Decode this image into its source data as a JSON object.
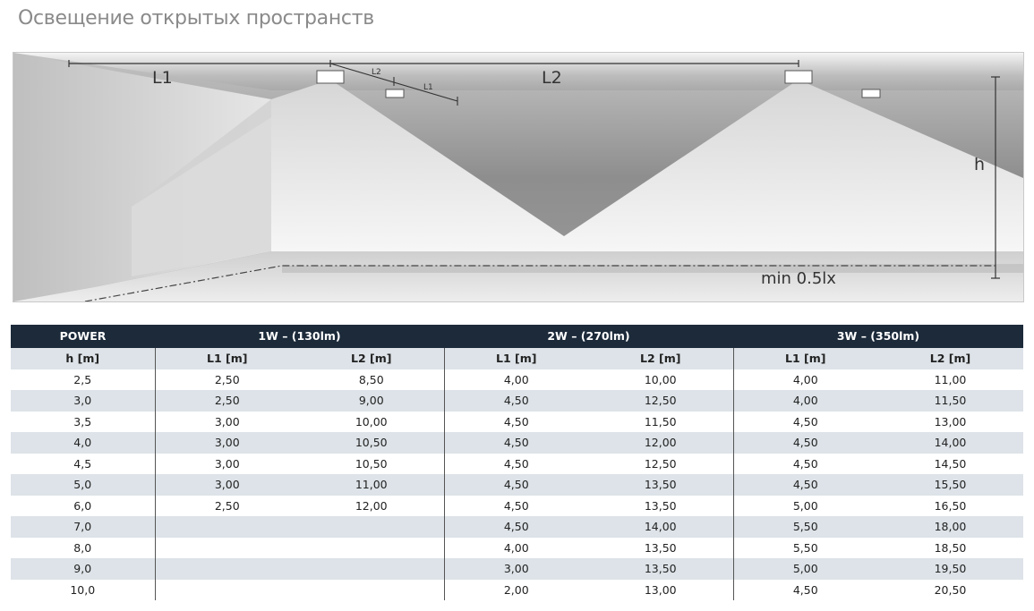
{
  "title": "Освещение открытых пространств",
  "diagram": {
    "l1": "L1",
    "l2": "L2",
    "l1_small": "L1",
    "l2_small": "L2",
    "h": "h",
    "min": "min 0.5lx"
  },
  "table": {
    "power_label": "POWER",
    "groups": [
      "1W – (130lm)",
      "2W – (270lm)",
      "3W – (350lm)"
    ],
    "sub_headers": [
      "h [m]",
      "L1 [m]",
      "L2 [m]",
      "L1 [m]",
      "L2 [m]",
      "L1 [m]",
      "L2 [m]"
    ],
    "rows": [
      [
        "2,5",
        "2,50",
        "8,50",
        "4,00",
        "10,00",
        "4,00",
        "11,00"
      ],
      [
        "3,0",
        "2,50",
        "9,00",
        "4,50",
        "12,50",
        "4,00",
        "11,50"
      ],
      [
        "3,5",
        "3,00",
        "10,00",
        "4,50",
        "11,50",
        "4,50",
        "13,00"
      ],
      [
        "4,0",
        "3,00",
        "10,50",
        "4,50",
        "12,00",
        "4,50",
        "14,00"
      ],
      [
        "4,5",
        "3,00",
        "10,50",
        "4,50",
        "12,50",
        "4,50",
        "14,50"
      ],
      [
        "5,0",
        "3,00",
        "11,00",
        "4,50",
        "13,50",
        "4,50",
        "15,50"
      ],
      [
        "6,0",
        "2,50",
        "12,00",
        "4,50",
        "13,50",
        "5,00",
        "16,50"
      ],
      [
        "7,0",
        "",
        "",
        "4,50",
        "14,00",
        "5,50",
        "18,00"
      ],
      [
        "8,0",
        "",
        "",
        "4,00",
        "13,50",
        "5,50",
        "18,50"
      ],
      [
        "9,0",
        "",
        "",
        "3,00",
        "13,50",
        "5,00",
        "19,50"
      ],
      [
        "10,0",
        "",
        "",
        "2,00",
        "13,00",
        "4,50",
        "20,50"
      ]
    ]
  }
}
